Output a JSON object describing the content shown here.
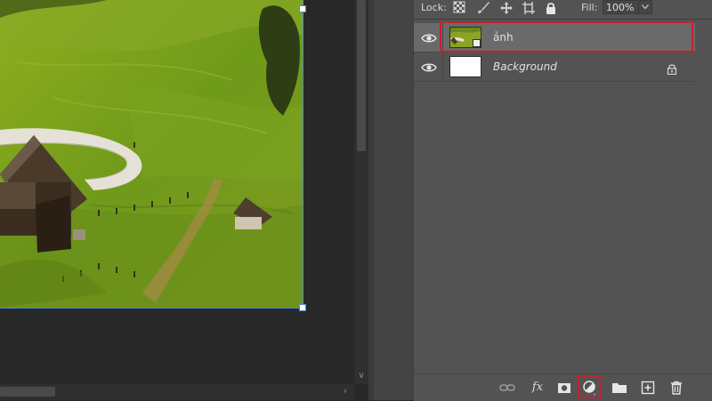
{
  "canvas": {
    "image_alt": "green hillside landscape with huts and curved path"
  },
  "layers_panel": {
    "lock_label": "Lock:",
    "lock_icons": [
      "lock-transparent-pixels-icon",
      "lock-image-pixels-icon",
      "lock-position-icon",
      "lock-artboard-icon",
      "lock-all-icon"
    ],
    "fill_label": "Fill:",
    "fill_value": "100%",
    "layers": [
      {
        "name": "ảnh",
        "visible": true,
        "selected": true,
        "type": "smart-object"
      },
      {
        "name": "Background",
        "visible": true,
        "selected": false,
        "locked": true
      }
    ],
    "bottom_buttons": [
      "link-layers-icon",
      "fx",
      "layer-mask-icon",
      "adjustment-layer-icon",
      "group-folder-icon",
      "new-layer-icon",
      "trash-icon"
    ],
    "fx_label": "fx"
  },
  "colors": {
    "highlight": "#c8202e",
    "panel_bg": "#535353",
    "selected_row": "#6a6a6a"
  }
}
